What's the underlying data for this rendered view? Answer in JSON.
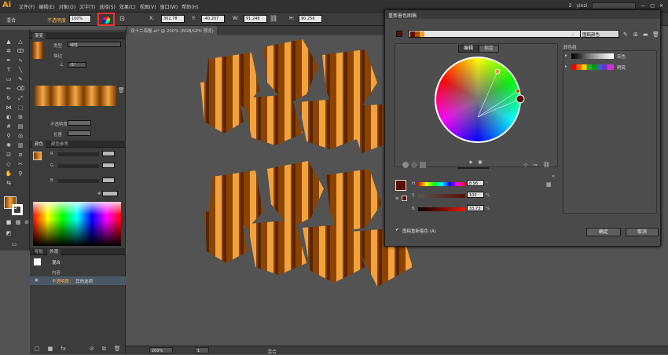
{
  "app": {
    "logo": "Ai",
    "user": "yinzi",
    "notif": "2"
  },
  "menu": [
    "文件(F)",
    "编辑(E)",
    "对象(O)",
    "文字(T)",
    "选择(S)",
    "效果(C)",
    "视图(V)",
    "窗口(W)",
    "帮助(H)"
  ],
  "control": {
    "mode": "混合",
    "opacity_label": "不透明度",
    "opacity_value": "100%",
    "x_value": "362.78",
    "y_value": "-40.207",
    "w_value": "91.248",
    "h_value": "90.256"
  },
  "swatch_panel": {
    "tab": "渐变",
    "type_label": "类型",
    "type_value": "线性",
    "stroke_label": "描边",
    "angle_value": "-5°",
    "opacity_label": "不透明度",
    "position_label": "位置"
  },
  "color_panel": {
    "tab_color": "颜色",
    "tab_guide": "颜色参考",
    "r": "R",
    "g": "G",
    "b": "B"
  },
  "appearance_panel": {
    "tab_nav": "导航",
    "tab_appear": "外观",
    "blend": "混合",
    "content": "内容",
    "opacity": "不透明度：",
    "other": "其他选项"
  },
  "document": {
    "tab": "双十二海报.ai* @ 200% (RGB/GPU 预览)",
    "zoom": "200%",
    "page": "1",
    "mode": "混合"
  },
  "dialog": {
    "title": "重新着色图稿",
    "name_field": "图稿颜色",
    "tab_edit": "编辑",
    "tab_assign": "指定",
    "groups_label": "颜色组",
    "group1": "灰色",
    "group2": "明亮",
    "h_label": "H",
    "h_value": "8.96",
    "h_unit": "°",
    "s_label": "S",
    "s_value": "100",
    "s_unit": "%",
    "b_label": "B",
    "b_value": "33.73",
    "b_unit": "%",
    "recolor_label": "图稿重新着色 (A)",
    "ok": "确定",
    "cancel": "取消",
    "checkmark": "✔"
  },
  "colors": {
    "accent": "#f7a11a",
    "sel_dark_red": "#5e0d04"
  }
}
